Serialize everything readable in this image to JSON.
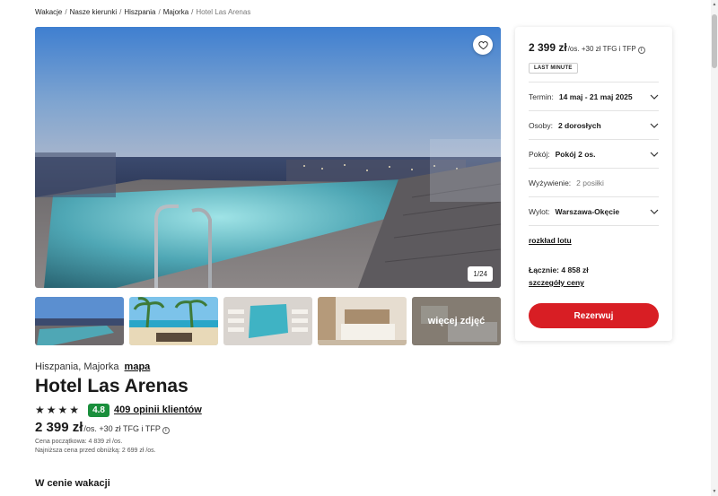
{
  "breadcrumb": {
    "items": [
      "Wakacje",
      "Nasze kierunki",
      "Hiszpania",
      "Majorka"
    ],
    "current": "Hotel Las Arenas",
    "separator": "/"
  },
  "gallery": {
    "counter": "1/24",
    "more_label": "więcej zdjęć",
    "thumbnails": [
      "hotel-pool-night",
      "beach-terrace",
      "rooftop-pool",
      "hotel-room-1",
      "hotel-room-2"
    ]
  },
  "hotel": {
    "location": "Hiszpania, Majorka",
    "map_link": "mapa",
    "name": "Hotel Las Arenas",
    "stars": 4,
    "score": "4.8",
    "reviews": "409 opinii klientów",
    "price": "2 399 zł",
    "price_suffix": "/os. +30 zł TFG i TFP",
    "note_start_price": "Cena początkowa: 4 839 zł /os.",
    "note_lowest_price": "Najniższa cena przed obniżką: 2 699 zł /os."
  },
  "section": {
    "title": "W cenie wakacji"
  },
  "booking": {
    "price": "2 399 zł",
    "price_suffix": "/os. +30 zł TFG i TFP",
    "badge": "LAST MINUTE",
    "termin_label": "Termin:",
    "termin_value": "14 maj - 21 maj 2025",
    "osoby_label": "Osoby:",
    "osoby_value": "2 dorosłych",
    "pokoj_label": "Pokój:",
    "pokoj_value": "Pokój 2 os.",
    "wyzywienie_label": "Wyżywienie:",
    "wyzywienie_value": "2 posiłki",
    "wylot_label": "Wylot:",
    "wylot_value": "Warszawa-Okęcie",
    "flight_link": "rozkład lotu",
    "total": "Łącznie: 4 858 zł",
    "details_link": "szczegóły ceny",
    "reserve_button": "Rezerwuj"
  },
  "colors": {
    "accent_red": "#d81e24",
    "rating_green": "#1a8f3c"
  }
}
